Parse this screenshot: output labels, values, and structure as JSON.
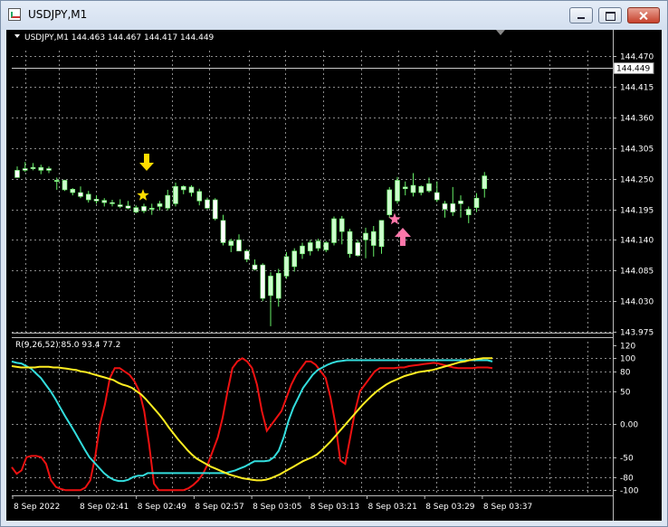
{
  "window": {
    "title": "USDJPY,M1",
    "icons": {
      "app": "chart-window-icon",
      "minimize": "minimize-icon",
      "maximize": "maximize-icon",
      "close": "close-icon"
    }
  },
  "chart_info": {
    "label": "USDJPY,M1  144.463 144.467 144.417 144.449",
    "toggle_icon": "triangle-down-icon"
  },
  "indicator_info": {
    "label": "R(9,26,52) 85.0 93.4 77.2"
  },
  "markers": {
    "sell": {
      "icon": "down-arrow-icon",
      "color": "#ffdd00",
      "candle": 16
    },
    "buy": {
      "icon": "up-arrow-icon",
      "color": "#ff77aa",
      "candle": 48
    },
    "star_yellow": {
      "icon": "star-icon",
      "color": "#ffdd00",
      "candle": 16,
      "price": 144.22
    },
    "star_pink": {
      "icon": "star-icon",
      "color": "#ff77aa",
      "candle": 48,
      "price": 144.177
    }
  },
  "colors": {
    "background": "#000000",
    "grid": "#8a8a8a",
    "bull": "#ccffcc",
    "bear": "#ffffff",
    "wick": "#66ee66",
    "line_red": "#ee1111",
    "line_cyan": "#33dddd",
    "line_yellow": "#ffee22",
    "bid_line": "#c8c8c8"
  },
  "chart_data": [
    {
      "type": "candlestick",
      "symbol": "USDJPY",
      "timeframe": "M1",
      "ylim": [
        143.975,
        144.48
      ],
      "y_ticks": [
        "144.470",
        "144.415",
        "144.360",
        "144.305",
        "144.250",
        "144.195",
        "144.140",
        "144.085",
        "144.030",
        "143.975"
      ],
      "current_price": "144.449",
      "x_ticks": [
        "8 Sep 2022",
        "8 Sep 02:41",
        "8 Sep 02:49",
        "8 Sep 02:57",
        "8 Sep 03:05",
        "8 Sep 03:13",
        "8 Sep 03:21",
        "8 Sep 03:29",
        "8 Sep 03:37"
      ],
      "candles": [
        [
          144.265,
          144.272,
          144.252,
          144.252
        ],
        [
          144.268,
          144.28,
          144.262,
          144.265
        ],
        [
          144.27,
          144.278,
          144.265,
          144.268
        ],
        [
          144.265,
          144.275,
          144.258,
          144.27
        ],
        [
          144.268,
          144.272,
          144.26,
          144.265
        ],
        [
          144.245,
          144.252,
          144.23,
          144.247
        ],
        [
          144.23,
          144.248,
          144.228,
          144.247
        ],
        [
          144.225,
          144.233,
          144.22,
          144.231
        ],
        [
          144.225,
          144.236,
          144.215,
          144.218
        ],
        [
          144.212,
          144.228,
          144.207,
          144.222
        ],
        [
          144.213,
          144.22,
          144.205,
          144.21
        ],
        [
          144.207,
          144.215,
          144.2,
          144.211
        ],
        [
          144.207,
          144.212,
          144.2,
          144.205
        ],
        [
          144.203,
          144.213,
          144.197,
          144.2
        ],
        [
          144.201,
          144.21,
          144.195,
          144.197
        ],
        [
          144.19,
          144.202,
          144.188,
          144.198
        ],
        [
          144.2,
          144.205,
          144.188,
          144.192
        ],
        [
          144.195,
          144.205,
          144.185,
          144.197
        ],
        [
          144.2,
          144.21,
          144.193,
          144.205
        ],
        [
          144.197,
          144.23,
          144.193,
          144.22
        ],
        [
          144.205,
          144.243,
          144.2,
          144.236
        ],
        [
          144.23,
          144.238,
          144.222,
          144.236
        ],
        [
          144.225,
          144.238,
          144.218,
          144.235
        ],
        [
          144.21,
          144.232,
          144.202,
          144.227
        ],
        [
          144.212,
          144.216,
          144.195,
          144.197
        ],
        [
          144.212,
          144.215,
          144.175,
          144.178
        ],
        [
          144.175,
          144.185,
          144.13,
          144.135
        ],
        [
          144.13,
          144.142,
          144.118,
          144.138
        ],
        [
          144.14,
          144.15,
          144.132,
          144.12
        ],
        [
          144.12,
          144.123,
          144.1,
          144.105
        ],
        [
          144.095,
          144.105,
          144.085,
          144.087
        ],
        [
          144.095,
          144.098,
          144.03,
          144.035
        ],
        [
          144.04,
          144.082,
          143.985,
          144.075
        ],
        [
          144.035,
          144.088,
          144.02,
          144.08
        ],
        [
          144.075,
          144.118,
          144.07,
          144.11
        ],
        [
          144.092,
          144.125,
          144.083,
          144.12
        ],
        [
          144.115,
          144.135,
          144.106,
          144.129
        ],
        [
          144.12,
          144.14,
          144.112,
          144.135
        ],
        [
          144.125,
          144.142,
          144.12,
          144.138
        ],
        [
          144.122,
          144.138,
          144.118,
          144.135
        ],
        [
          144.135,
          144.182,
          144.13,
          144.178
        ],
        [
          144.155,
          144.183,
          144.132,
          144.178
        ],
        [
          144.115,
          144.16,
          144.108,
          144.155
        ],
        [
          144.135,
          144.14,
          144.11,
          144.112
        ],
        [
          144.14,
          144.162,
          144.107,
          144.152
        ],
        [
          144.13,
          144.165,
          144.11,
          144.155
        ],
        [
          144.128,
          144.175,
          144.115,
          144.175
        ],
        [
          144.185,
          144.235,
          144.18,
          144.23
        ],
        [
          144.21,
          144.253,
          144.205,
          144.247
        ],
        [
          144.232,
          144.245,
          144.22,
          144.235
        ],
        [
          144.225,
          144.26,
          144.218,
          144.238
        ],
        [
          144.225,
          144.238,
          144.22,
          144.236
        ],
        [
          144.228,
          144.252,
          144.225,
          144.241
        ],
        [
          144.225,
          144.245,
          144.208,
          144.212
        ],
        [
          144.205,
          144.21,
          144.18,
          144.195
        ],
        [
          144.205,
          144.235,
          144.183,
          144.19
        ],
        [
          144.21,
          144.22,
          144.18,
          144.205
        ],
        [
          144.185,
          144.2,
          144.17,
          144.195
        ],
        [
          144.198,
          144.224,
          144.19,
          144.215
        ],
        [
          144.232,
          144.262,
          144.216,
          144.255
        ]
      ]
    },
    {
      "type": "line",
      "indicator": "R(9,26,52)",
      "ylim": [
        -105,
        125
      ],
      "y_ticks": [
        "120",
        "100",
        "80",
        "50",
        "0.00",
        "-50",
        "-80",
        "-100"
      ],
      "series": [
        {
          "values": [
            -65,
            -75,
            -70,
            -50,
            -48,
            -48,
            -50,
            -60,
            -85,
            -95,
            -98,
            -100,
            -100,
            -100,
            -100,
            -96,
            -85,
            -50,
            0,
            30,
            70,
            85,
            85,
            80,
            75,
            65,
            50,
            20,
            -30,
            -90,
            -100,
            -100,
            -100,
            -100,
            -100,
            -100,
            -97,
            -92,
            -85,
            -75,
            -60,
            -40,
            -20,
            10,
            50,
            85,
            95,
            100,
            95,
            85,
            60,
            20,
            -10,
            0,
            10,
            20,
            40,
            60,
            75,
            85,
            95,
            95,
            90,
            80,
            70,
            40,
            0,
            -55,
            -60,
            -20,
            20,
            50,
            60,
            70,
            80,
            85,
            85,
            85,
            85,
            86,
            86,
            88,
            89,
            90,
            91,
            92,
            93,
            92,
            90,
            88,
            86,
            85,
            85,
            85,
            85,
            86,
            86,
            86,
            85
          ]
        },
        {
          "values": [
            95,
            93,
            92,
            88,
            84,
            77,
            70,
            60,
            50,
            38,
            25,
            12,
            0,
            -12,
            -25,
            -38,
            -50,
            -58,
            -66,
            -74,
            -80,
            -84,
            -86,
            -86,
            -84,
            -80,
            -78,
            -78,
            -74,
            -74,
            -74,
            -74,
            -74,
            -74,
            -74,
            -74,
            -74,
            -74,
            -74,
            -74,
            -74,
            -74,
            -74,
            -74,
            -74,
            -72,
            -70,
            -67,
            -64,
            -60,
            -56,
            -56,
            -56,
            -55,
            -50,
            -40,
            -20,
            5,
            25,
            40,
            55,
            65,
            75,
            82,
            86,
            90,
            93,
            95,
            96,
            97,
            97,
            97,
            97,
            97,
            97,
            97,
            97,
            97,
            97,
            97,
            97,
            97,
            97,
            97,
            97,
            97,
            97,
            97,
            97,
            97,
            97,
            97,
            97,
            97,
            97,
            97,
            97,
            97,
            97,
            95
          ]
        },
        {
          "values": [
            88,
            87,
            86,
            86,
            86,
            86,
            87,
            87,
            87,
            86,
            86,
            85,
            84,
            83,
            82,
            80,
            79,
            77,
            75,
            73,
            71,
            69,
            67,
            63,
            60,
            58,
            55,
            50,
            45,
            38,
            30,
            22,
            14,
            5,
            -5,
            -14,
            -23,
            -31,
            -39,
            -46,
            -52,
            -56,
            -60,
            -64,
            -67,
            -70,
            -73,
            -76,
            -78,
            -80,
            -82,
            -83,
            -84,
            -85,
            -85,
            -84,
            -82,
            -79,
            -76,
            -72,
            -68,
            -64,
            -60,
            -56,
            -53,
            -50,
            -46,
            -40,
            -33,
            -26,
            -18,
            -10,
            -2,
            6,
            14,
            22,
            30,
            37,
            44,
            50,
            55,
            60,
            64,
            67,
            70,
            73,
            75,
            77,
            79,
            80,
            81,
            82,
            84,
            86,
            88,
            90,
            92,
            94,
            95,
            97,
            98,
            99,
            100,
            100,
            100
          ]
        }
      ]
    }
  ]
}
